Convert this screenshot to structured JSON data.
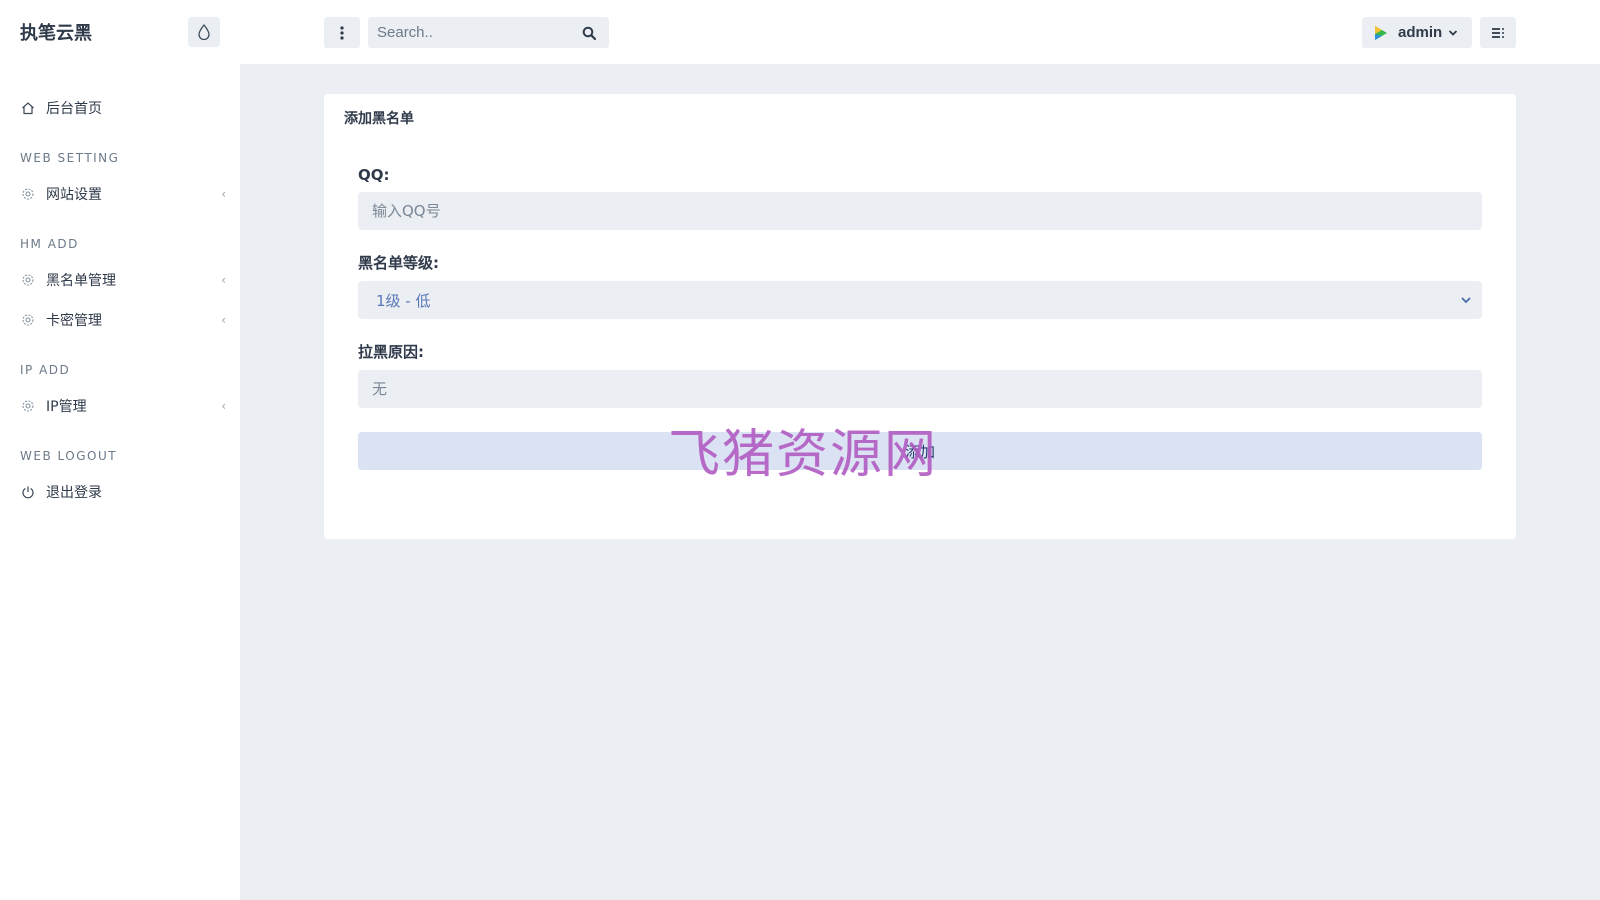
{
  "brand": {
    "title": "执笔云黑"
  },
  "header": {
    "search_placeholder": "Search..",
    "user_name": "admin"
  },
  "sidebar": {
    "items": [
      {
        "type": "link",
        "label": "后台首页",
        "icon": "home-icon"
      },
      {
        "type": "heading",
        "label": "WEB SETTING"
      },
      {
        "type": "link",
        "label": "网站设置",
        "icon": "gear-icon",
        "has_submenu": true
      },
      {
        "type": "heading",
        "label": "HM ADD"
      },
      {
        "type": "link",
        "label": "黑名单管理",
        "icon": "gear-icon",
        "has_submenu": true
      },
      {
        "type": "link",
        "label": "卡密管理",
        "icon": "gear-icon",
        "has_submenu": true
      },
      {
        "type": "heading",
        "label": "IP ADD"
      },
      {
        "type": "link",
        "label": "IP管理",
        "icon": "gear-icon",
        "has_submenu": true
      },
      {
        "type": "heading",
        "label": "WEB LOGOUT"
      },
      {
        "type": "link",
        "label": "退出登录",
        "icon": "power-icon"
      }
    ]
  },
  "card": {
    "title": "添加黑名单",
    "qq_label": "QQ:",
    "qq_placeholder": "输入QQ号",
    "level_label": "黑名单等级:",
    "level_value": "1级 - 低",
    "reason_label": "拉黑原因:",
    "reason_placeholder": "无",
    "submit_label": "添加"
  },
  "watermark": "飞猪资源网",
  "colors": {
    "background": "#ebeef2",
    "panel": "#ffffff",
    "submit_bg": "#dae2f3",
    "select_text": "#5b78b8",
    "watermark": "#b15bc2"
  }
}
